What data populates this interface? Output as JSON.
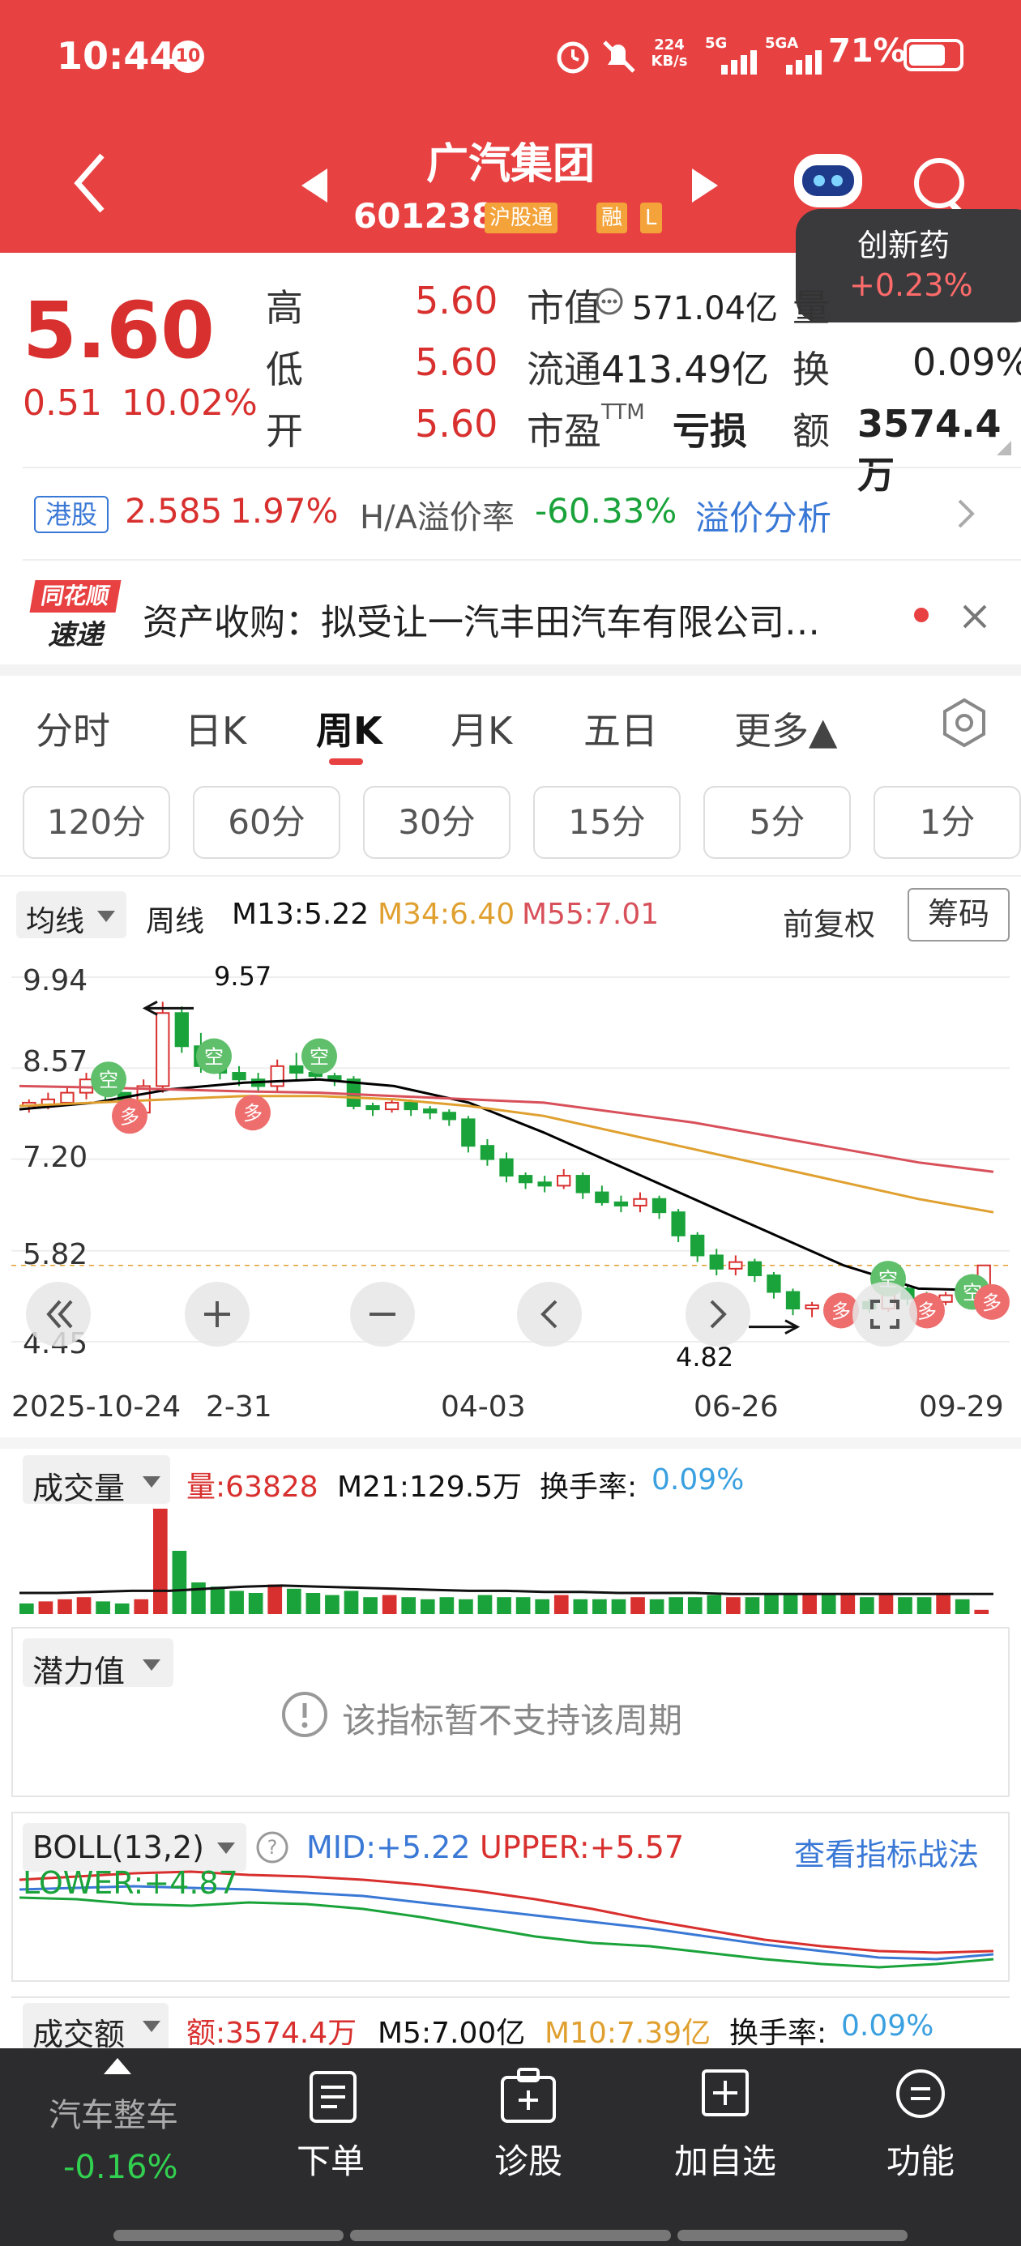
{
  "status_bar": {
    "time": "10:44",
    "badge": "10",
    "speed_top": "224",
    "speed_bottom": "KB/s",
    "net1": "5G",
    "net2": "5GA",
    "battery": "71%",
    "battery_level": 0.71
  },
  "header": {
    "stock_name": "广汽集团",
    "stock_code": "601238",
    "tag_connect": "沪股通",
    "tag_margin": "融",
    "tag_l": "L",
    "back_icon": "chevron-left-icon",
    "prev_icon": "triangle-left-icon",
    "next_icon": "triangle-right-icon"
  },
  "popup": {
    "title": "创新药",
    "change": "+0.23%"
  },
  "quote": {
    "price": "5.60",
    "change": "0.51",
    "change_pct": "10.02%",
    "high_label": "高",
    "high": "5.60",
    "low_label": "低",
    "low": "5.60",
    "open_label": "开",
    "open": "5.60",
    "mcap_label": "市值",
    "mcap": "571.04亿",
    "float_label": "流通",
    "float": "413.49亿",
    "pe_label": "市盈",
    "pe_sup": "TTM",
    "pe": "亏损",
    "vol_label": "量",
    "turnover_label": "换",
    "turnover": "0.09%",
    "amount_label": "额",
    "amount": "3574.4万"
  },
  "hk": {
    "badge": "港股",
    "price": "2.585",
    "pct": "1.97%",
    "premium_label": "H/A溢价率",
    "premium": "-60.33%",
    "analysis": "溢价分析"
  },
  "news": {
    "logo_top": "同花顺",
    "logo_bottom": "速递",
    "text": "资产收购：拟受让一汽丰田汽车有限公司…"
  },
  "tabs": [
    "分时",
    "日K",
    "周K",
    "月K",
    "五日",
    "更多▲"
  ],
  "periods": [
    "120分",
    "60分",
    "30分",
    "15分",
    "5分",
    "1分"
  ],
  "kline": {
    "ma_dropdown": "均线",
    "period": "周线",
    "m13": "M13:5.22",
    "m34": "M34:6.40",
    "m55": "M55:7.01",
    "adjust": "前复权",
    "chips": "筹码",
    "y_labels": [
      "9.94",
      "8.57",
      "7.20",
      "5.82",
      "4.45"
    ],
    "x_labels": [
      "2025-10-24",
      "2-31",
      "04-03",
      "06-26",
      "09-29"
    ],
    "high_mark": "9.57",
    "low_mark": "4.82",
    "buy_label": "多",
    "sell_label": "空"
  },
  "chart_data": {
    "type": "candlestick",
    "title": "",
    "ylim": [
      4.45,
      9.94
    ],
    "x_ticks": [
      "2025-10-24",
      "04-03",
      "06-26",
      "09-29"
    ],
    "series": [
      {
        "name": "M13",
        "last": 5.22
      },
      {
        "name": "M34",
        "last": 6.4
      },
      {
        "name": "M55",
        "last": 7.01
      }
    ],
    "annotations": {
      "max": 9.57,
      "min": 4.82
    }
  },
  "volume": {
    "label": "成交量",
    "vol": "量:63828",
    "m21": "M21:129.5万",
    "turn_label": "换手率:",
    "turn": "0.09%"
  },
  "potential": {
    "label": "潜力值",
    "msg": "该指标暂不支持该周期"
  },
  "boll": {
    "label": "BOLL(13,2)",
    "mid": "MID:+5.22",
    "upper": "UPPER:+5.57",
    "lower": "LOWER:+4.87",
    "link": "查看指标战法"
  },
  "amount_ind": {
    "label": "成交额",
    "amt": "额:3574.4万",
    "m5": "M5:7.00亿",
    "m10": "M10:7.39亿",
    "turn_label": "换手率:",
    "turn": "0.09%"
  },
  "bottom": {
    "sector": "汽车整车",
    "sector_change": "-0.16%",
    "items": [
      "下单",
      "诊股",
      "加自选",
      "功能"
    ]
  },
  "colors": {
    "red": "#e84142",
    "up": "#d8302e",
    "down": "#1aa33a",
    "m13": "#000000",
    "m34": "#e0a030",
    "m55": "#d8505a"
  }
}
